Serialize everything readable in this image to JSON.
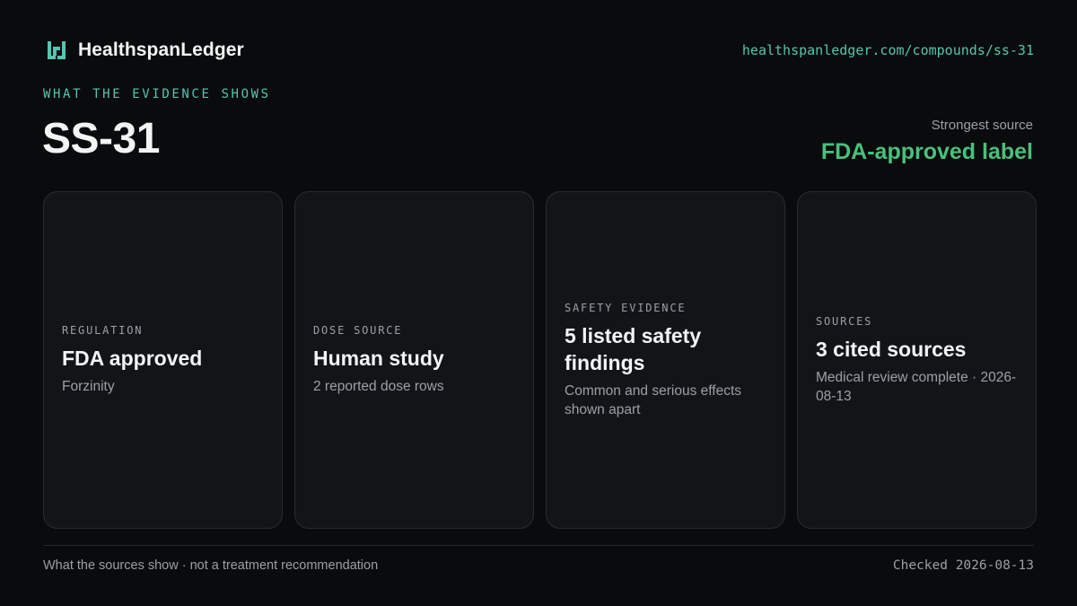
{
  "brand": {
    "name": "HealthspanLedger",
    "logo_icon": "ledger-logo-icon",
    "accent_color": "#55c5b0"
  },
  "url": "healthspanledger.com/compounds/ss-31",
  "eyebrow": "WHAT THE EVIDENCE SHOWS",
  "page_title": "SS-31",
  "strongest_source": {
    "label": "Strongest source",
    "value": "FDA-approved label",
    "color": "#49c07c"
  },
  "cards": [
    {
      "label": "REGULATION",
      "title": "FDA approved",
      "subtitle": "Forzinity"
    },
    {
      "label": "DOSE SOURCE",
      "title": "Human study",
      "subtitle": "2 reported dose rows"
    },
    {
      "label": "SAFETY EVIDENCE",
      "title": "5 listed safety findings",
      "subtitle": "Common and serious effects shown apart"
    },
    {
      "label": "SOURCES",
      "title": "3 cited sources",
      "subtitle": "Medical review complete · 2026-08-13"
    }
  ],
  "footer": {
    "disclaimer": "What the sources show · not a treatment recommendation",
    "checked": "Checked 2026-08-13"
  }
}
